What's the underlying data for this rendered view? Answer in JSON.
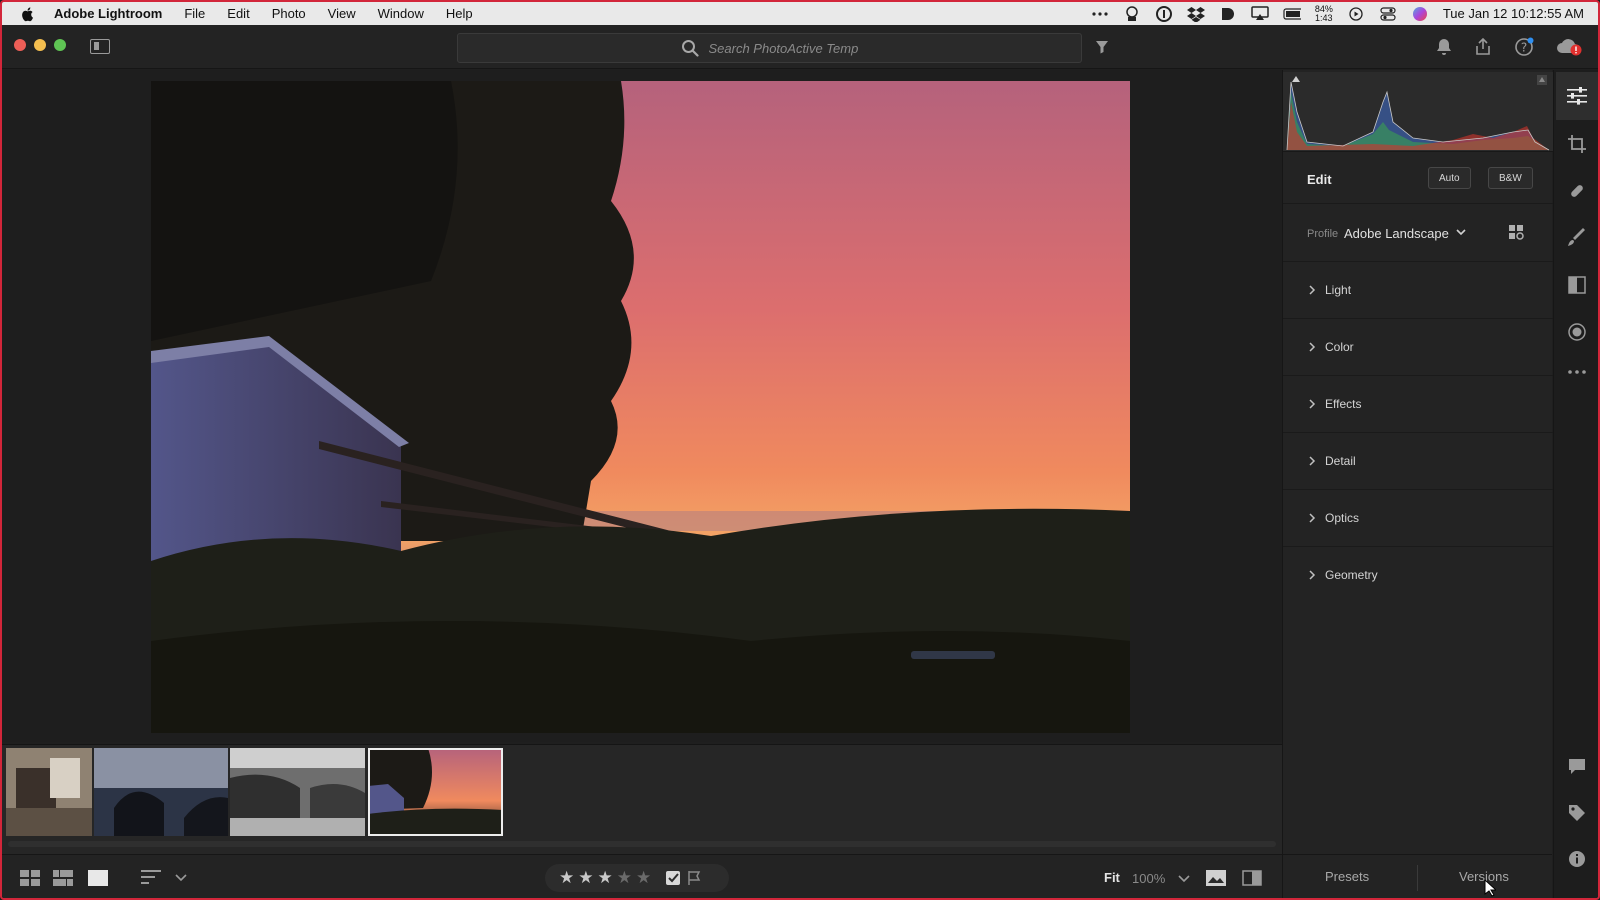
{
  "menubar": {
    "app_name": "Adobe Lightroom",
    "items": [
      "File",
      "Edit",
      "Photo",
      "View",
      "Window",
      "Help"
    ],
    "battery_percent": "84%",
    "battery_time": "1:43",
    "datetime": "Tue Jan 12  10:12:55 AM"
  },
  "toolbar": {
    "search_placeholder": "Search PhotoActive Temp"
  },
  "edit_panel": {
    "title": "Edit",
    "auto_label": "Auto",
    "bw_label": "B&W",
    "profile_label": "Profile",
    "profile_value": "Adobe Landscape",
    "sections": [
      "Light",
      "Color",
      "Effects",
      "Detail",
      "Optics",
      "Geometry"
    ]
  },
  "bottombar": {
    "rating": 3,
    "max_rating": 5,
    "fit_label": "Fit",
    "zoom_label": "100%"
  },
  "pv_bar": {
    "presets_label": "Presets",
    "versions_label": "Versions"
  },
  "colors": {
    "accent_red": "#d2263a",
    "panel_bg": "#232323",
    "histogram_blue": "#3f6fd0",
    "histogram_red": "#d0342c",
    "histogram_green": "#3aa84a"
  },
  "icons": {
    "search": "magnifier-icon",
    "filter": "funnel-icon",
    "notifications": "bell-icon",
    "share": "share-icon",
    "help": "help-icon",
    "cloud": "cloud-icon"
  }
}
